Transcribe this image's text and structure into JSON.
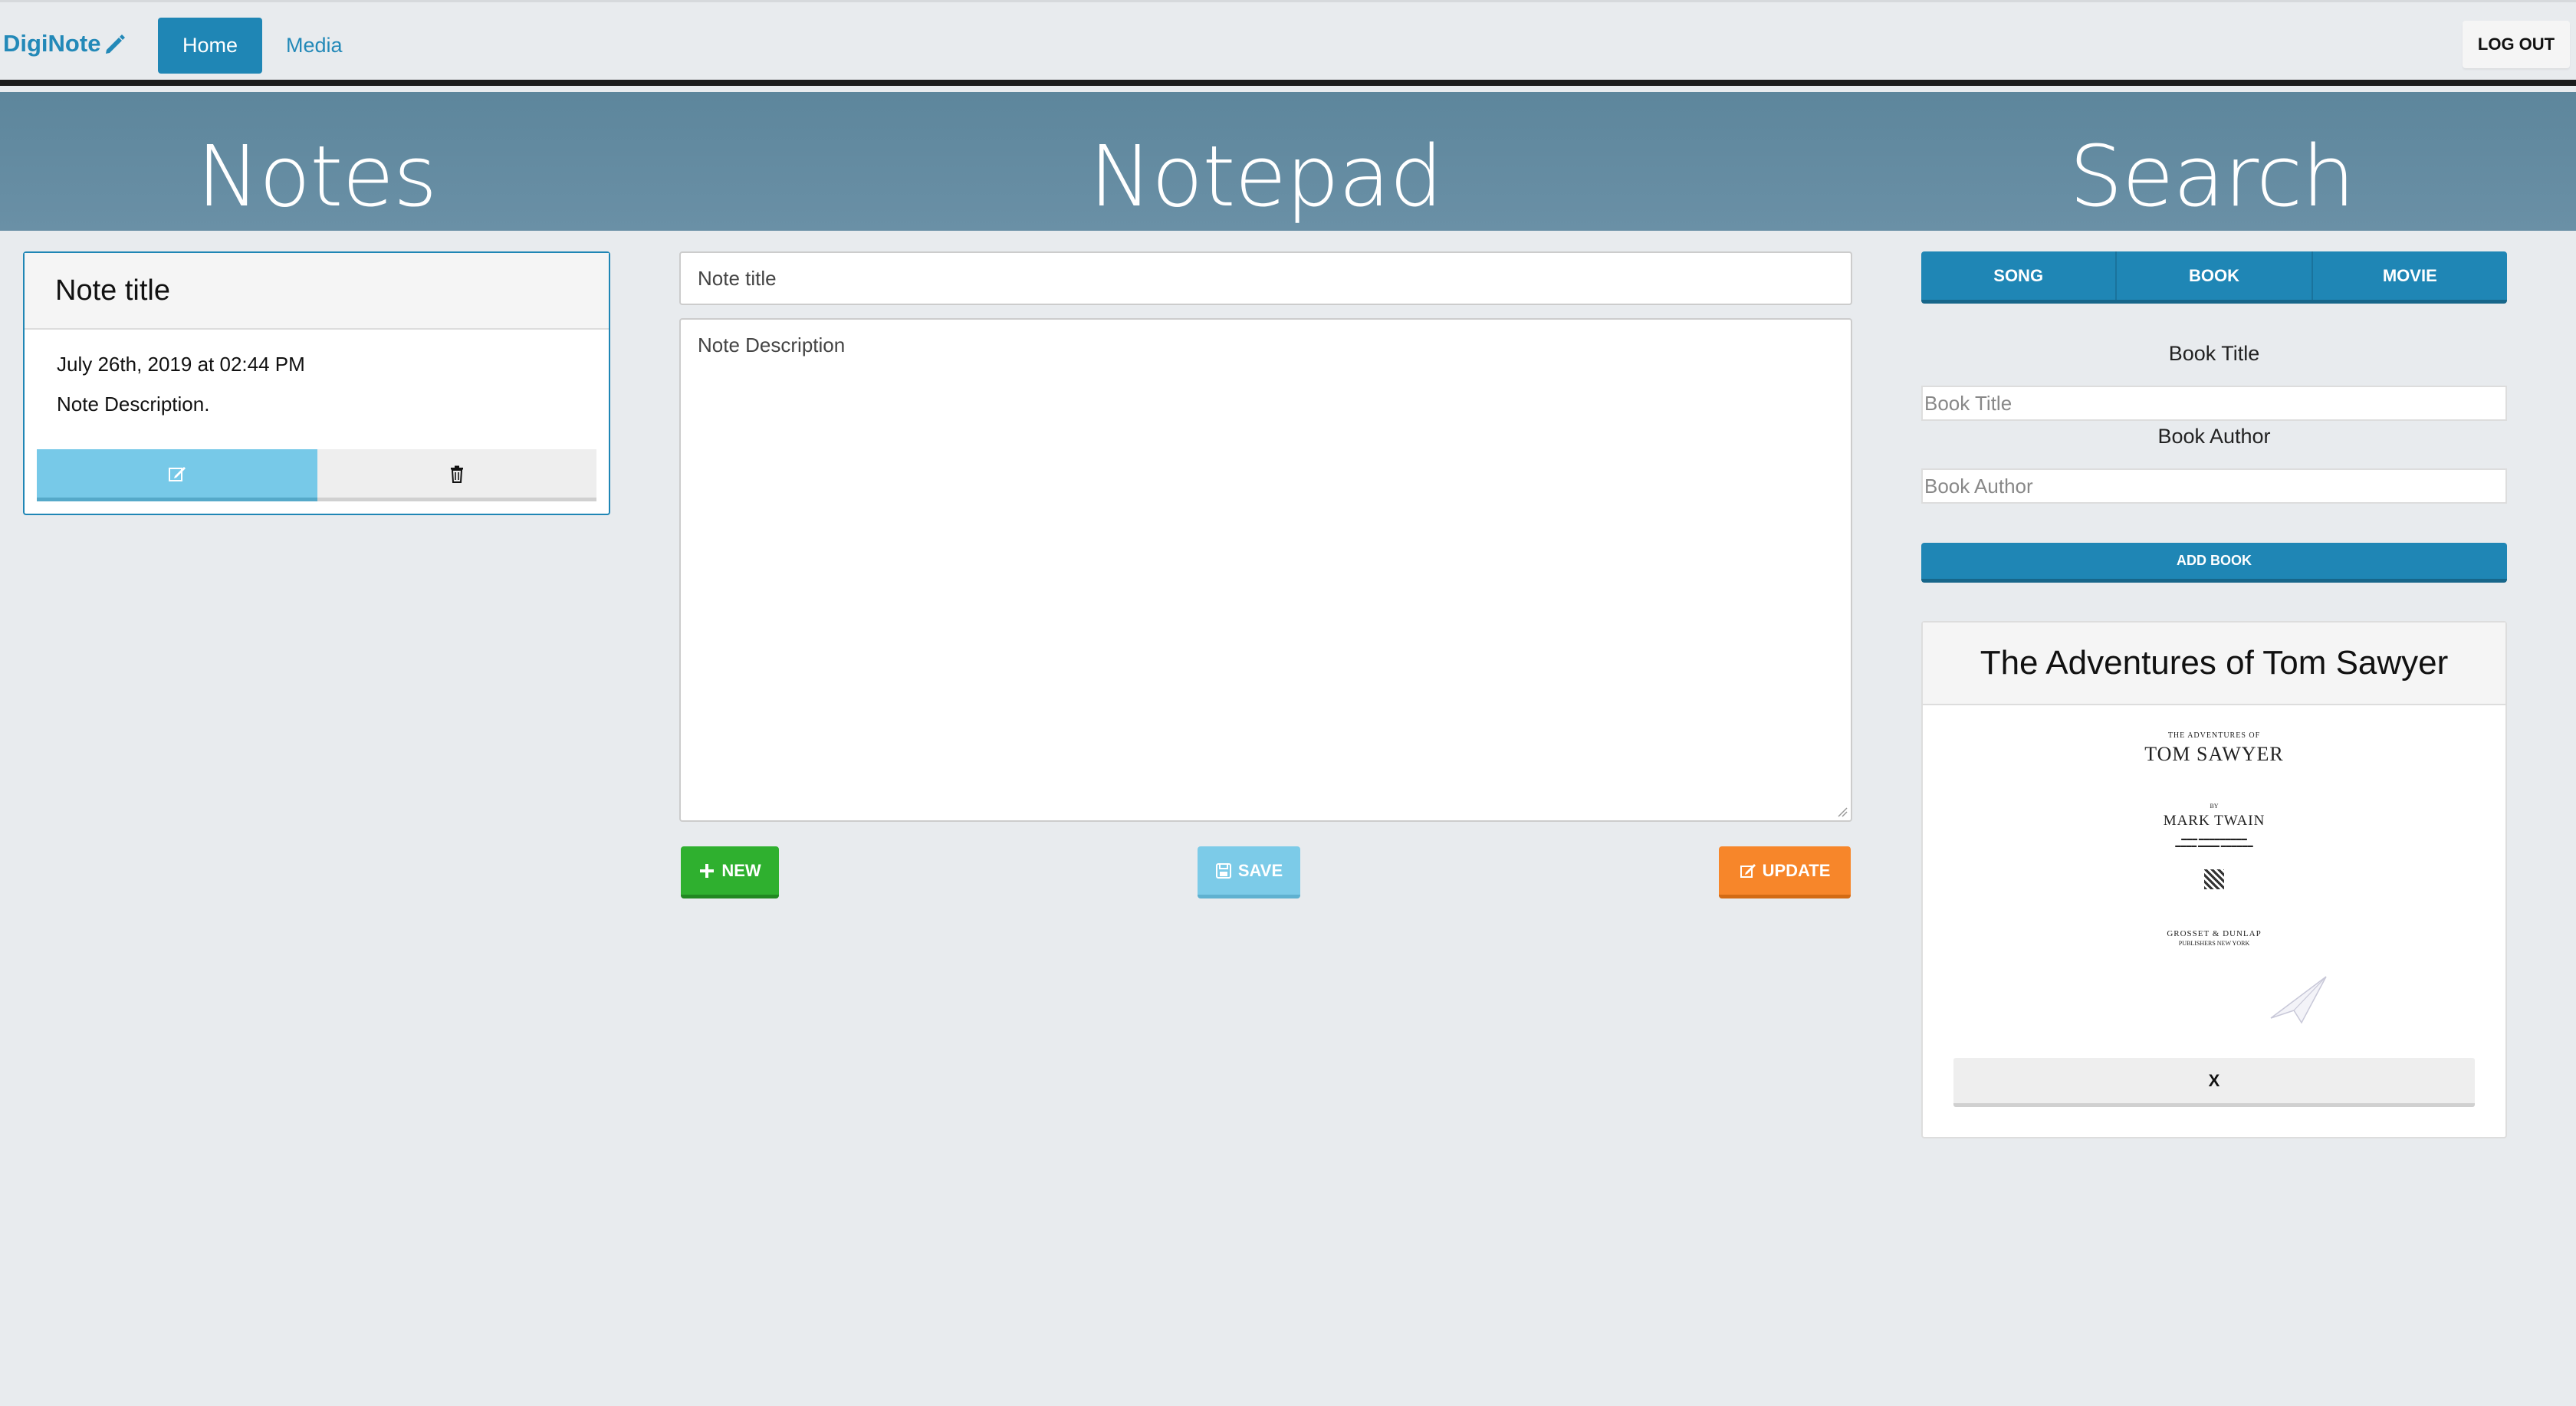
{
  "navbar": {
    "brand": "DigiNote",
    "brand_icon": "pencil-icon",
    "home_label": "Home",
    "media_label": "Media",
    "logout_label": "LOG OUT"
  },
  "hero": {
    "notes": "Notes",
    "notepad": "Notepad",
    "search": "Search"
  },
  "notes": {
    "items": [
      {
        "title": "Note title",
        "date": "July 26th, 2019 at 02:44 PM",
        "description": "Note Description."
      }
    ]
  },
  "notepad": {
    "title_placeholder": "Note title",
    "description_placeholder": "Note Description",
    "new_label": "NEW",
    "save_label": "SAVE",
    "update_label": "UPDATE"
  },
  "search": {
    "tabs": [
      "SONG",
      "BOOK",
      "MOVIE"
    ],
    "book_title_label": "Book Title",
    "book_title_placeholder": "Book Title",
    "book_author_label": "Book Author",
    "book_author_placeholder": "Book Author",
    "add_book_label": "ADD BOOK",
    "result": {
      "title": "The Adventures of Tom Sawyer",
      "close_label": "X",
      "cover": {
        "line1": "THE ADVENTURES OF",
        "line2": "TOM SAWYER",
        "by": "BY",
        "author": "MARK TWAIN",
        "publisher": "GROSSET & DUNLAP",
        "publisher_sub": "PUBLISHERS      NEW YORK"
      }
    }
  },
  "colors": {
    "primary": "#1f86b5",
    "hero": "#628ba1",
    "new": "#2fb02f",
    "save": "#7ccbe8",
    "update": "#f7862a",
    "background": "#e8ebee"
  }
}
